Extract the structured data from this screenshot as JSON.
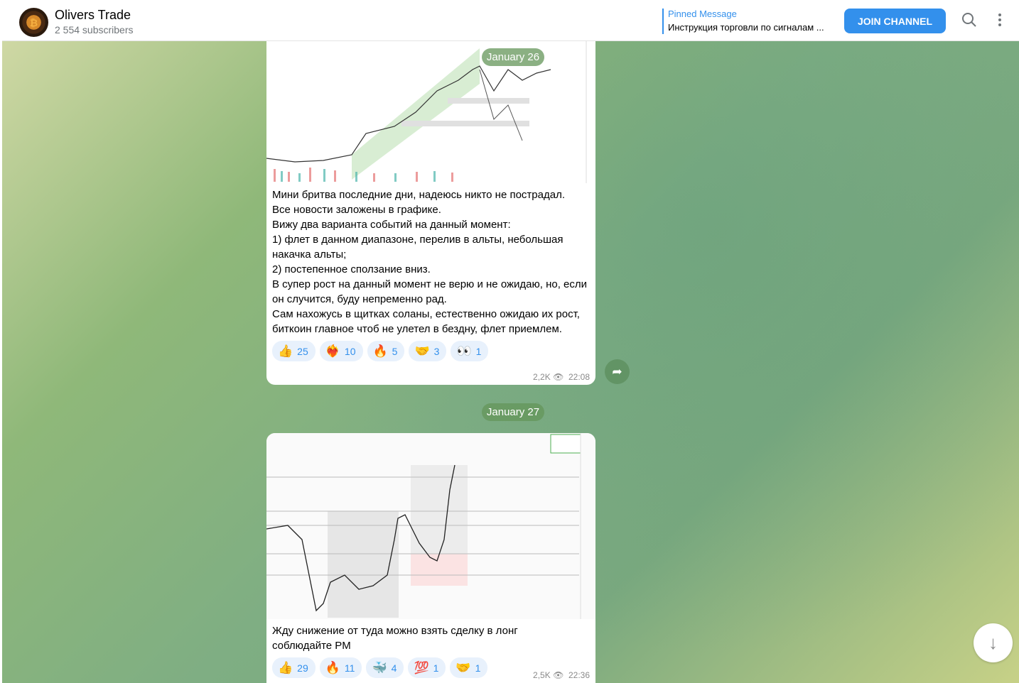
{
  "header": {
    "title": "Olivers Trade",
    "subscribers": "2 554 subscribers",
    "pinned_label": "Pinned Message",
    "pinned_text": "Инструкция торговли по сигналам ...",
    "join": "JOIN CHANNEL",
    "icons": [
      "search-icon",
      "more-vertical-icon"
    ]
  },
  "messages": [
    {
      "date": "January 26",
      "text": "Мини бритва последние дни, надеюсь никто не пострадал.\nВсе новости заложены в графике.\nВижу два варианта событий на данный момент:\n1) флет в данном диапазоне, перелив в альты, небольшая накачка альты;\n2) постепенное сползание вниз.\nВ супер рост на данный момент не верю и не ожидаю, но, если он случится, буду непременно рад.\nСам нахожусь в щитках соланы, естественно ожидаю их рост, биткоин главное чтоб не улетел в бездну, флет приемлем.",
      "reactions": [
        {
          "emoji": "👍",
          "count": "25"
        },
        {
          "emoji": "❤️‍🔥",
          "count": "10"
        },
        {
          "emoji": "🔥",
          "count": "5"
        },
        {
          "emoji": "🤝",
          "count": "3"
        },
        {
          "emoji": "👀",
          "count": "1"
        }
      ],
      "views": "2,2K",
      "time": "22:08"
    },
    {
      "date": "January 27",
      "text": "Жду снижение от туда можно взять сделку в лонг\nсоблюдайте PM",
      "reactions": [
        {
          "emoji": "👍",
          "count": "29"
        },
        {
          "emoji": "🔥",
          "count": "11"
        },
        {
          "emoji": "🐳",
          "count": "4"
        },
        {
          "emoji": "💯",
          "count": "1"
        },
        {
          "emoji": "🤝",
          "count": "1"
        }
      ],
      "views": "2,5K",
      "time": "22:36"
    }
  ]
}
